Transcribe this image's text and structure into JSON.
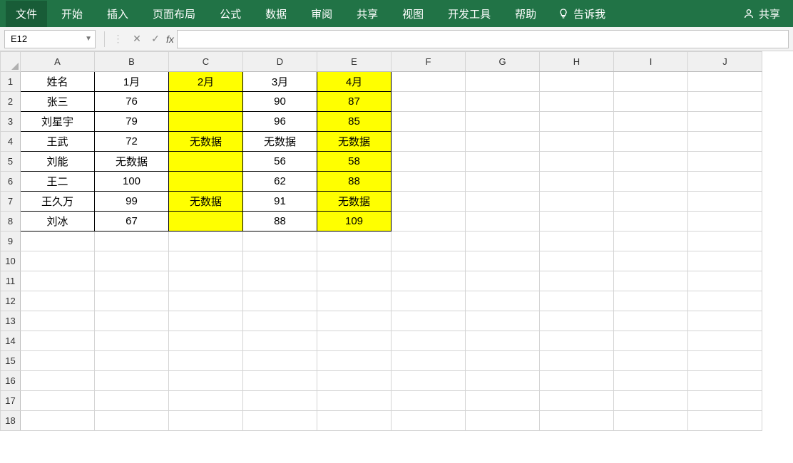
{
  "ribbon": {
    "tabs": [
      "文件",
      "开始",
      "插入",
      "页面布局",
      "公式",
      "数据",
      "审阅",
      "共享",
      "视图",
      "开发工具",
      "帮助"
    ],
    "tellme": "告诉我",
    "share": "共享"
  },
  "formulaBar": {
    "nameBox": "E12",
    "cancel": "✕",
    "confirm": "✓",
    "fx": "fx",
    "value": ""
  },
  "columns": [
    "A",
    "B",
    "C",
    "D",
    "E",
    "F",
    "G",
    "H",
    "I",
    "J"
  ],
  "totalRows": 18,
  "highlightCols": [
    2,
    4
  ],
  "dataRange": {
    "rows": 8,
    "cols": 5
  },
  "grid": [
    [
      "姓名",
      "1月",
      "2月",
      "3月",
      "4月"
    ],
    [
      "张三",
      "76",
      "",
      "90",
      "87"
    ],
    [
      "刘星宇",
      "79",
      "",
      "96",
      "85"
    ],
    [
      "王武",
      "72",
      "无数据",
      "无数据",
      "无数据"
    ],
    [
      "刘能",
      "无数据",
      "",
      "56",
      "58"
    ],
    [
      "王二",
      "100",
      "",
      "62",
      "88"
    ],
    [
      "王久万",
      "99",
      "无数据",
      "91",
      "无数据"
    ],
    [
      "刘冰",
      "67",
      "",
      "88",
      "109"
    ]
  ]
}
